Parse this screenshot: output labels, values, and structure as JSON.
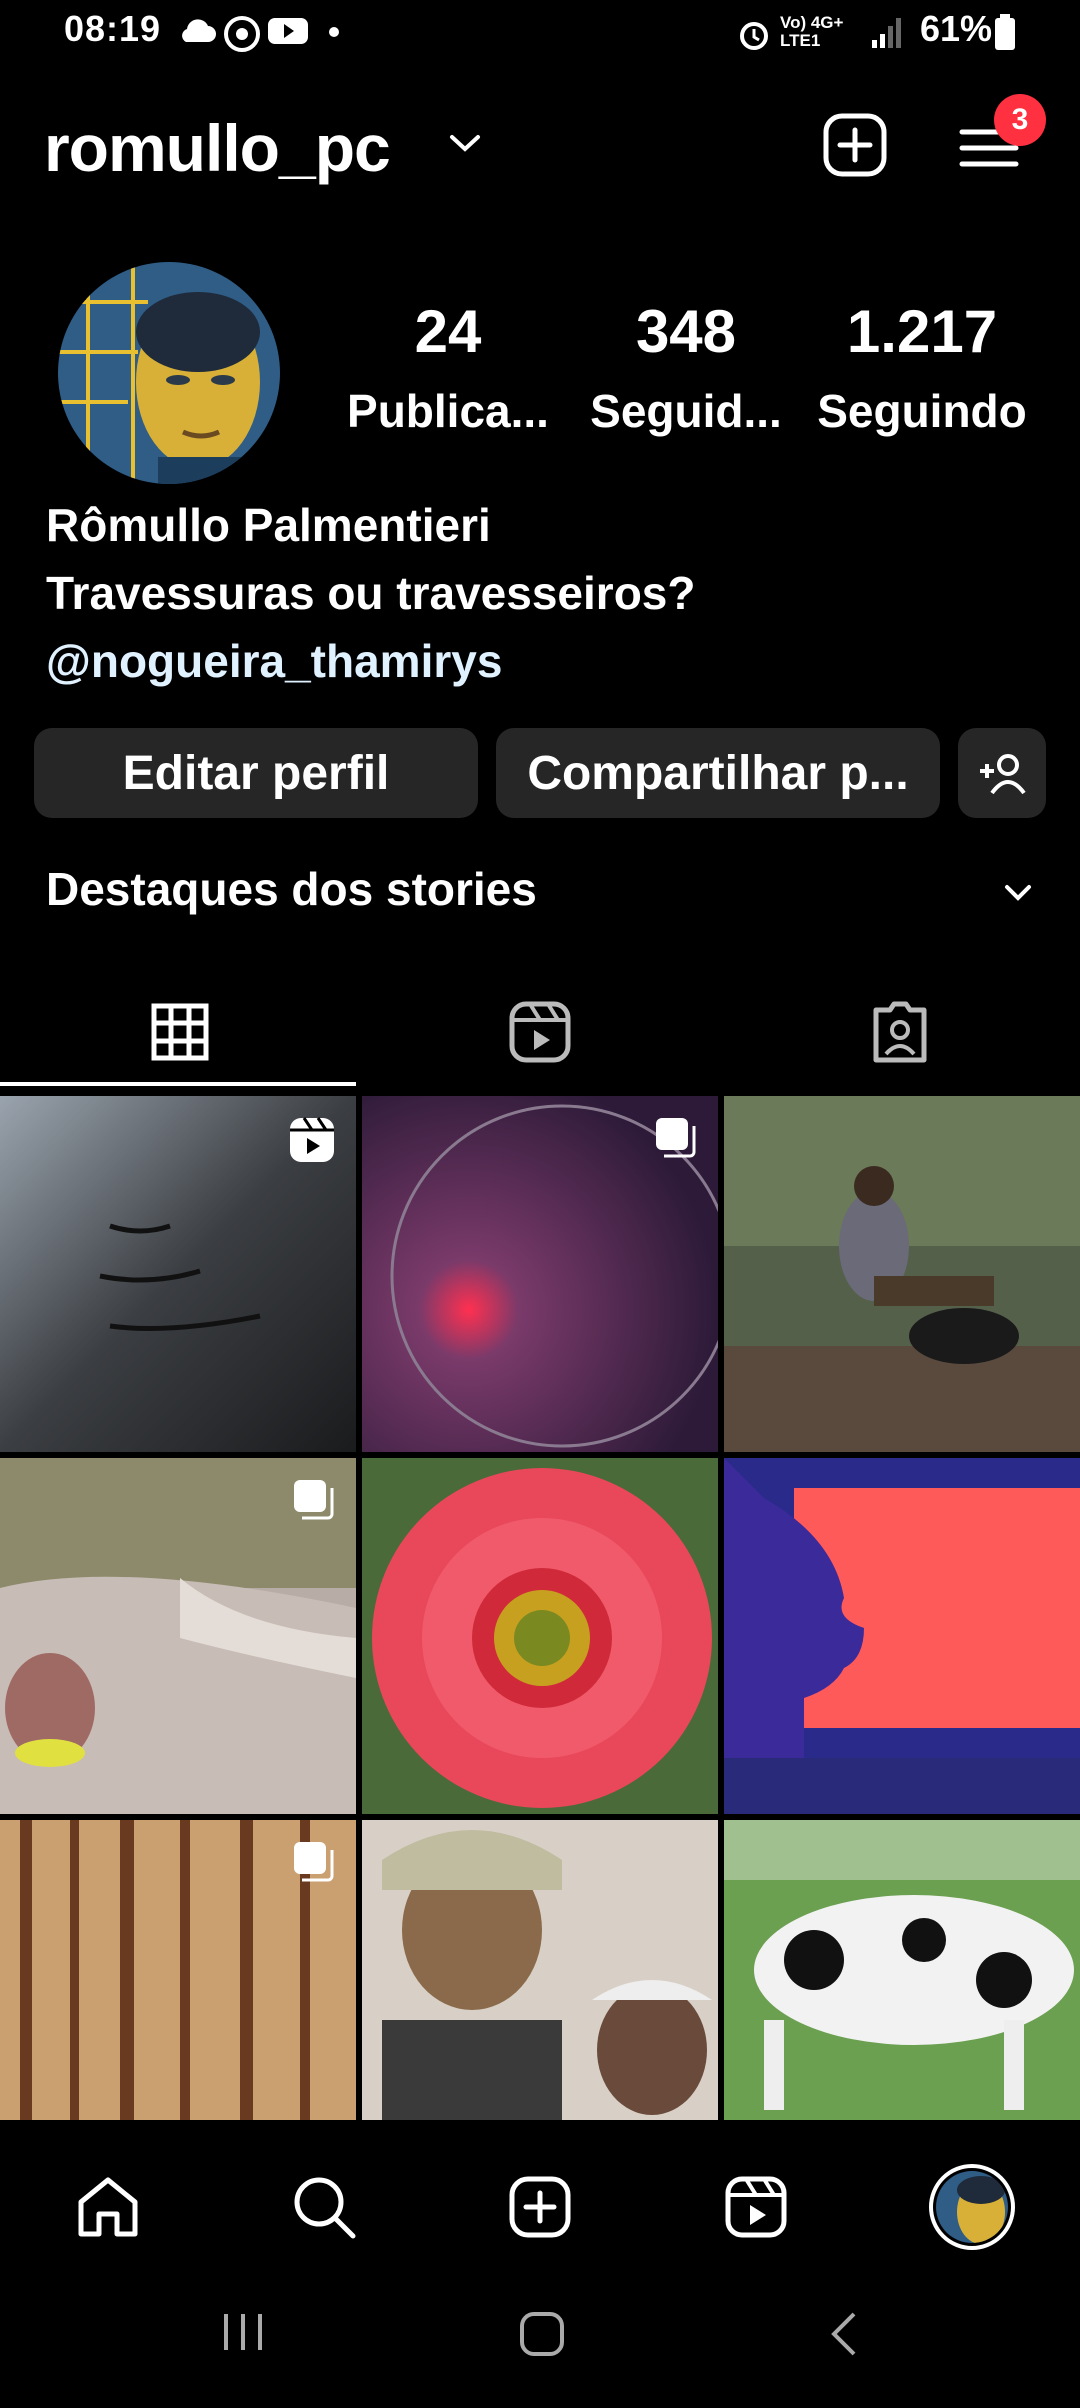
{
  "status_bar": {
    "time": "08:19",
    "network": "Vo) 4G+ LTE1",
    "battery": "61%"
  },
  "header": {
    "username": "romullo_pc",
    "notification_count": "3"
  },
  "profile": {
    "stats": [
      {
        "value": "24",
        "label": "Publica..."
      },
      {
        "value": "348",
        "label": "Seguid..."
      },
      {
        "value": "1.217",
        "label": "Seguindo"
      }
    ],
    "full_name": "Rômullo Palmentieri",
    "bio": "Travessuras ou travesseiros?",
    "mention": "@nogueira_thamirys"
  },
  "actions": {
    "edit_label": "Editar perfil",
    "share_label": "Compartilhar p..."
  },
  "highlights": {
    "label": "Destaques dos stories"
  },
  "tabs": [
    "grid-icon",
    "reels-icon",
    "tagged-icon"
  ],
  "grid_posts": [
    {
      "desc": "graffiti wall",
      "type": "reel"
    },
    {
      "desc": "dark red light",
      "type": "carousel"
    },
    {
      "desc": "man with dog",
      "type": "photo"
    },
    {
      "desc": "waterfall",
      "type": "carousel"
    },
    {
      "desc": "red flower",
      "type": "photo"
    },
    {
      "desc": "shadow silhouette",
      "type": "photo"
    },
    {
      "desc": "forest",
      "type": "carousel"
    },
    {
      "desc": "two people",
      "type": "photo"
    },
    {
      "desc": "cow",
      "type": "photo"
    }
  ],
  "colors": {
    "background": "#000000",
    "button": "#262626",
    "badge": "#ff3040",
    "mention": "#e0f1ff"
  }
}
